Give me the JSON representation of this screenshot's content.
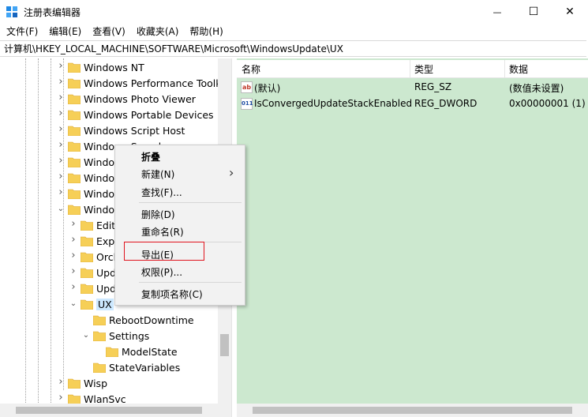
{
  "window": {
    "title": "注册表编辑器",
    "minimize_symbol": "—",
    "maximize_symbol": "☐",
    "close_symbol": "✕"
  },
  "menubar": {
    "items": [
      "文件(F)",
      "编辑(E)",
      "查看(V)",
      "收藏夹(A)",
      "帮助(H)"
    ]
  },
  "address": {
    "path": "计算机\\HKEY_LOCAL_MACHINE\\SOFTWARE\\Microsoft\\WindowsUpdate\\UX"
  },
  "tree": {
    "items": [
      {
        "label": "Windows NT",
        "state": "collapsed"
      },
      {
        "label": "Windows Performance Toolk",
        "state": "collapsed"
      },
      {
        "label": "Windows Photo Viewer",
        "state": "collapsed"
      },
      {
        "label": "Windows Portable Devices",
        "state": "collapsed"
      },
      {
        "label": "Windows Script Host",
        "state": "collapsed"
      },
      {
        "label": "Windows Search",
        "state": "collapsed"
      },
      {
        "label": "Windows Security",
        "state": "collapsed"
      },
      {
        "label": "Windows Server",
        "state": "collapsed"
      },
      {
        "label": "Windows Sidebar",
        "state": "collapsed"
      },
      {
        "label": "WindowsUpdate",
        "state": "expanded"
      },
      {
        "label": "Edition",
        "state": "collapsed"
      },
      {
        "label": "ExpressUpdate",
        "state": "collapsed"
      },
      {
        "label": "Orchestrator",
        "state": "collapsed"
      },
      {
        "label": "UpdatePolicy",
        "state": "collapsed"
      },
      {
        "label": "UpdateHandlers",
        "state": "collapsed"
      },
      {
        "label": "UX",
        "state": "expanded"
      },
      {
        "label": "RebootDowntime",
        "state": "none"
      },
      {
        "label": "Settings",
        "state": "expanded"
      },
      {
        "label": "ModelState",
        "state": "none"
      },
      {
        "label": "StateVariables",
        "state": "none"
      },
      {
        "label": "Wisp",
        "state": "collapsed"
      },
      {
        "label": "WlanSvc",
        "state": "collapsed"
      }
    ],
    "selected": "UX"
  },
  "values": {
    "columns": [
      "名称",
      "类型",
      "数据"
    ],
    "rows": [
      {
        "name": "(默认)",
        "type": "REG_SZ",
        "data": "(数值未设置)",
        "icon": "ab"
      },
      {
        "name": "IsConvergedUpdateStackEnabled",
        "type": "REG_DWORD",
        "data": "0x00000001 (1)",
        "icon": "011"
      }
    ]
  },
  "context_menu": {
    "items": [
      "折叠",
      "新建(N)",
      "查找(F)...",
      "删除(D)",
      "重命名(R)",
      "导出(E)",
      "权限(P)...",
      "复制项名称(C)"
    ],
    "submenu_arrow": "›",
    "highlighted": "导出(E)"
  },
  "colors": {
    "values_background": "#cce8cf",
    "selection": "#cce8ff",
    "highlight_box": "#e0141e",
    "folder": "#f6cf57"
  }
}
